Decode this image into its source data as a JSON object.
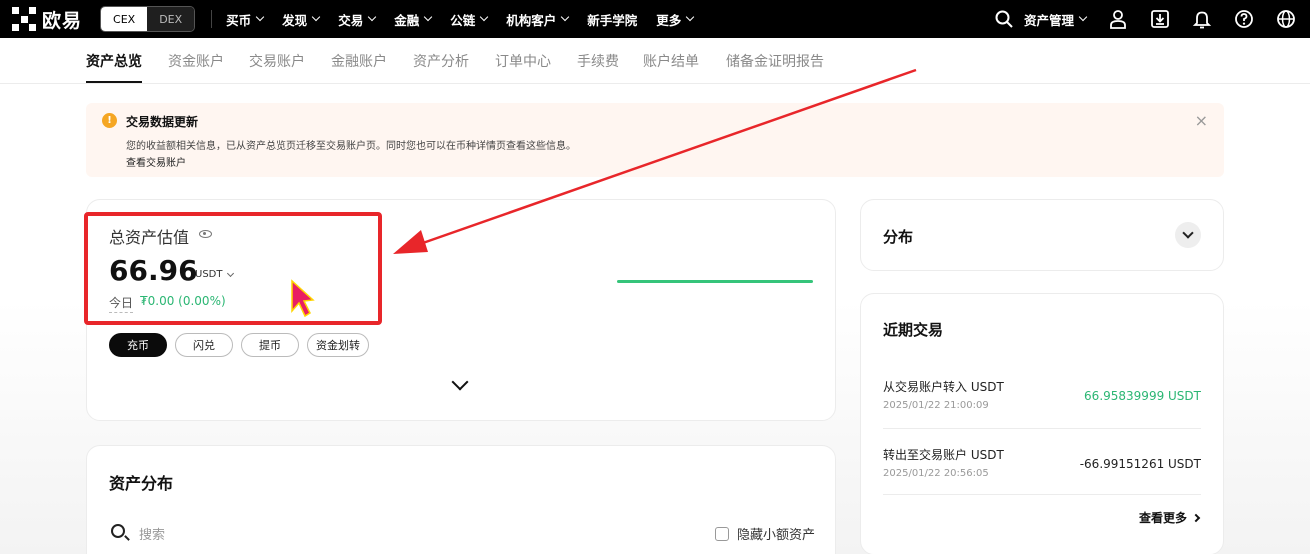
{
  "brand": {
    "name": "欧易"
  },
  "mode_switch": {
    "cex": "CEX",
    "dex": "DEX"
  },
  "nav": {
    "items": [
      "买币",
      "发现",
      "交易",
      "金融",
      "公链",
      "机构客户",
      "新手学院",
      "更多"
    ],
    "has_dropdown": [
      true,
      true,
      true,
      true,
      true,
      true,
      false,
      true
    ],
    "asset_management": "资产管理"
  },
  "subtabs": [
    "资产总览",
    "资金账户",
    "交易账户",
    "金融账户",
    "资产分析",
    "订单中心",
    "手续费",
    "账户结单",
    "储备金证明报告"
  ],
  "banner": {
    "icon": "!",
    "title": "交易数据更新",
    "desc": "您的收益额相关信息，已从资产总览页迁移至交易账户页。同时您也可以在币种详情页查看这些信息。",
    "link": "查看交易账户",
    "close": "×"
  },
  "total": {
    "label": "总资产估值",
    "value": "66.96",
    "unit": "USDT",
    "today_label": "今日",
    "today_pnl": "₮0.00 (0.00%)"
  },
  "actions": [
    "充币",
    "闪兑",
    "提币",
    "资金划转"
  ],
  "distribution": {
    "title": "资产分布",
    "search_placeholder": "搜索",
    "hide_small": "隐藏小额资产"
  },
  "side": {
    "fenbu_title": "分布",
    "recent_title": "近期交易",
    "transactions": [
      {
        "name": "从交易账户转入 USDT",
        "time": "2025/01/22 21:00:09",
        "amount": "66.95839999 USDT",
        "positive": true
      },
      {
        "name": "转出至交易账户 USDT",
        "time": "2025/01/22 20:56:05",
        "amount": "-66.99151261 USDT",
        "positive": false
      }
    ],
    "more": "查看更多"
  },
  "colors": {
    "accent_green": "#2bb673",
    "annotation_red": "#e8262a",
    "warning": "#f5a623"
  }
}
